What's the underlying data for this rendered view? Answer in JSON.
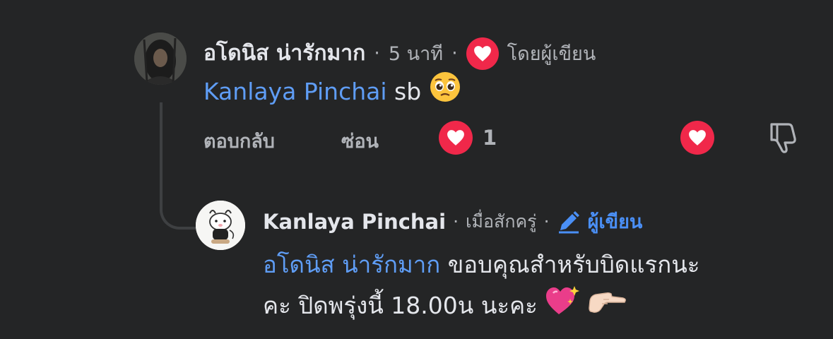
{
  "comment": {
    "author": "อโดนิส น่ารักมาก",
    "time": "5 นาที",
    "separator": "·",
    "loved_by": "โดยผู้เขียน",
    "mention": "Kanlaya Pinchai",
    "text": "sb",
    "emoji": "pleading-face-emoji",
    "actions": {
      "reply": "ตอบกลับ",
      "hide": "ซ่อน"
    },
    "reaction_count": "1",
    "colors": {
      "heart": "#f0284a",
      "mention": "#5f9df5",
      "background": "#242526"
    }
  },
  "reply": {
    "author": "Kanlaya Pinchai",
    "time": "เมื่อสักครู่",
    "separator": "·",
    "badge": "ผู้เขียน",
    "mention": "อโดนิส น่ารักมาก",
    "text_line1": "ขอบคุณสำหรับบิดแรกนะ",
    "text_line2": "คะ ปิดพรุ่งนี้ 18.00น นะคะ",
    "emojis": [
      "sparkling-heart-emoji",
      "pointing-hand-emoji"
    ],
    "badge_color": "#4a8ff5"
  }
}
